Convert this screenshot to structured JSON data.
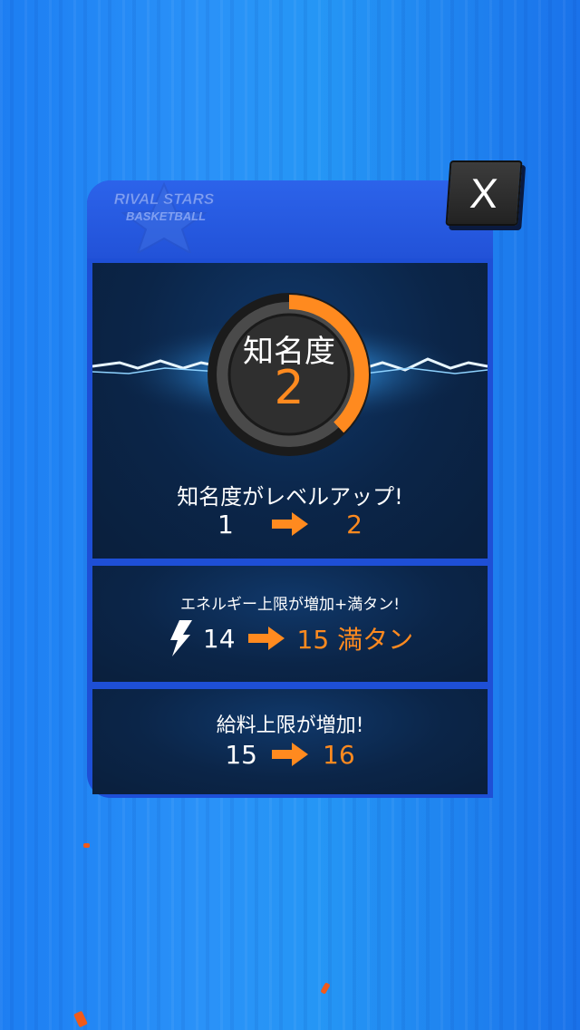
{
  "header": {
    "logo_text": "RIVAL STARS BASKETBALL",
    "close_label": "X"
  },
  "fame": {
    "badge_title": "知名度",
    "level": "2",
    "progress": 0.38
  },
  "level_up": {
    "title": "知名度がレベルアップ!",
    "from": "1",
    "to": "2"
  },
  "energy": {
    "title": "エネルギー上限が増加+満タン!",
    "from": "14",
    "to": "15 満タン"
  },
  "salary": {
    "title": "給料上限が増加!",
    "from": "15",
    "to": "16"
  },
  "colors": {
    "accent": "#ff8a1f",
    "panel": "#1e4fd6",
    "section": "#0b2548"
  }
}
